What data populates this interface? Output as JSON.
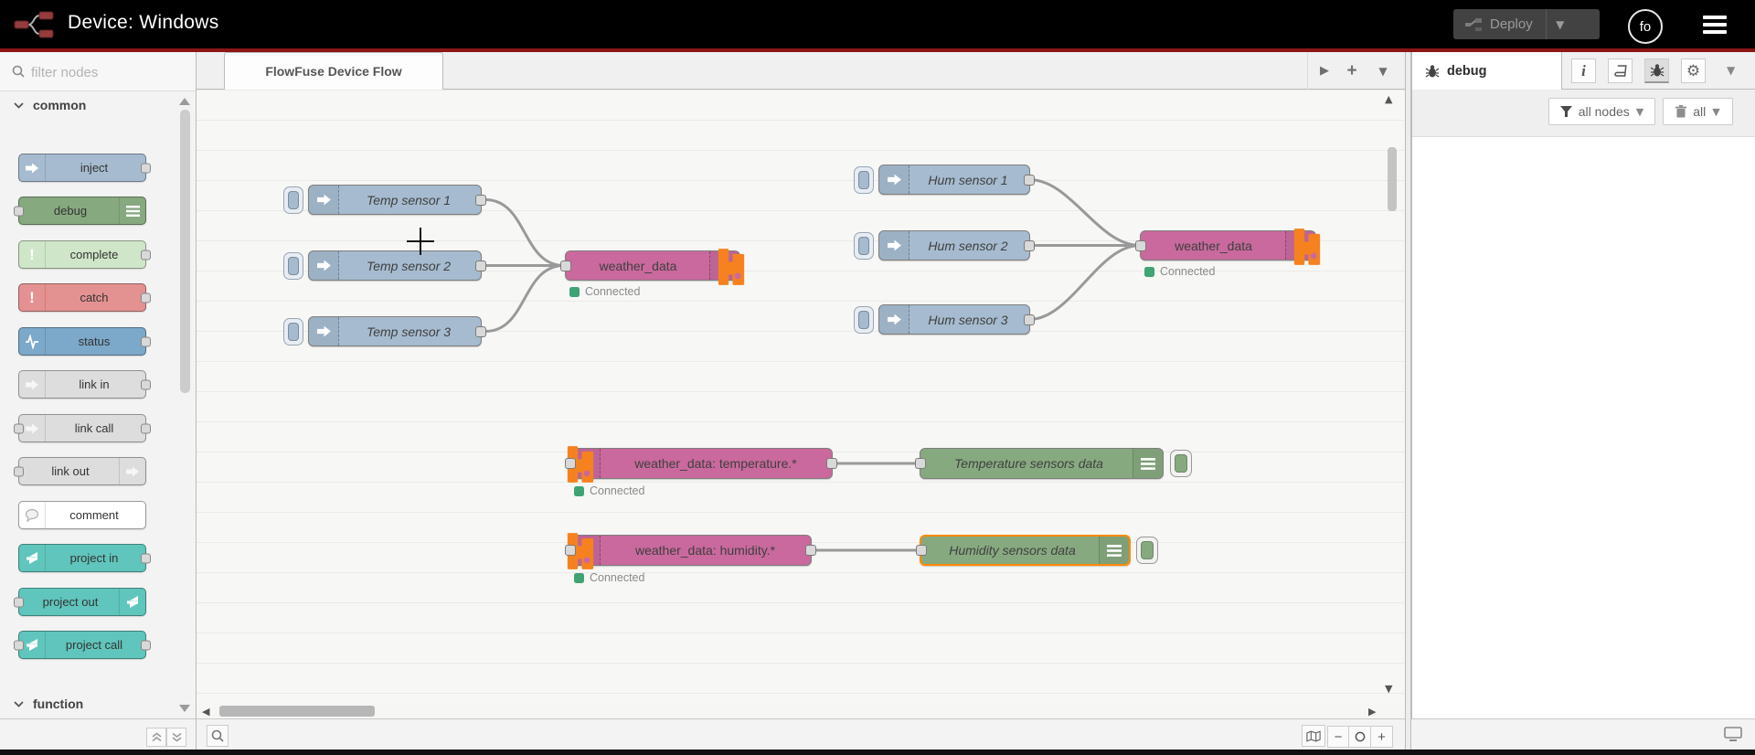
{
  "header": {
    "title": "Device: Windows",
    "deploy": {
      "label": "Deploy"
    },
    "avatar_initials": "fo"
  },
  "palette": {
    "filter_placeholder": "filter nodes",
    "categories": [
      {
        "label": "common"
      },
      {
        "label": "function"
      }
    ],
    "nodes": [
      {
        "label": "inject",
        "color": "#a6bbcf"
      },
      {
        "label": "debug",
        "color": "#87a980"
      },
      {
        "label": "complete",
        "color": "#cfe6c8"
      },
      {
        "label": "catch",
        "color": "#e49191"
      },
      {
        "label": "status",
        "color": "#7ca8c9"
      },
      {
        "label": "link in",
        "color": "#dddddd"
      },
      {
        "label": "link call",
        "color": "#dddddd"
      },
      {
        "label": "link out",
        "color": "#dddddd"
      },
      {
        "label": "comment",
        "color": "#ffffff"
      },
      {
        "label": "project in",
        "color": "#60c5bc"
      },
      {
        "label": "project out",
        "color": "#60c5bc"
      },
      {
        "label": "project call",
        "color": "#60c5bc"
      }
    ]
  },
  "workspace": {
    "tab_label": "FlowFuse Device Flow"
  },
  "canvas": {
    "nodes": [
      {
        "label": "Temp sensor 1"
      },
      {
        "label": "Temp sensor 2"
      },
      {
        "label": "Temp sensor 3"
      },
      {
        "label": "weather_data",
        "status": "Connected"
      },
      {
        "label": "Hum sensor 1"
      },
      {
        "label": "Hum sensor 2"
      },
      {
        "label": "Hum sensor 3"
      },
      {
        "label": "weather_data",
        "status": "Connected"
      },
      {
        "label": "weather_data: temperature.*",
        "status": "Connected"
      },
      {
        "label": "Temperature sensors data"
      },
      {
        "label": "weather_data: humidity.*",
        "status": "Connected"
      },
      {
        "label": "Humidity sensors data"
      }
    ]
  },
  "debug": {
    "tab_label": "debug",
    "filter_button": "all nodes",
    "clear_button": "all"
  },
  "colors": {
    "header_bg": "#000000",
    "header_border_red": "#8c1616",
    "node_sensor_blue": "#a6bbcf",
    "node_debug_green": "#87a980",
    "node_project_pink": "#c9699d",
    "node_project_teal": "#60c5bc",
    "flowfuse_orange": "#f5821f",
    "selected_outline": "#ff8a00",
    "status_dot_green": "#40a373",
    "wire_gray": "#999999"
  }
}
